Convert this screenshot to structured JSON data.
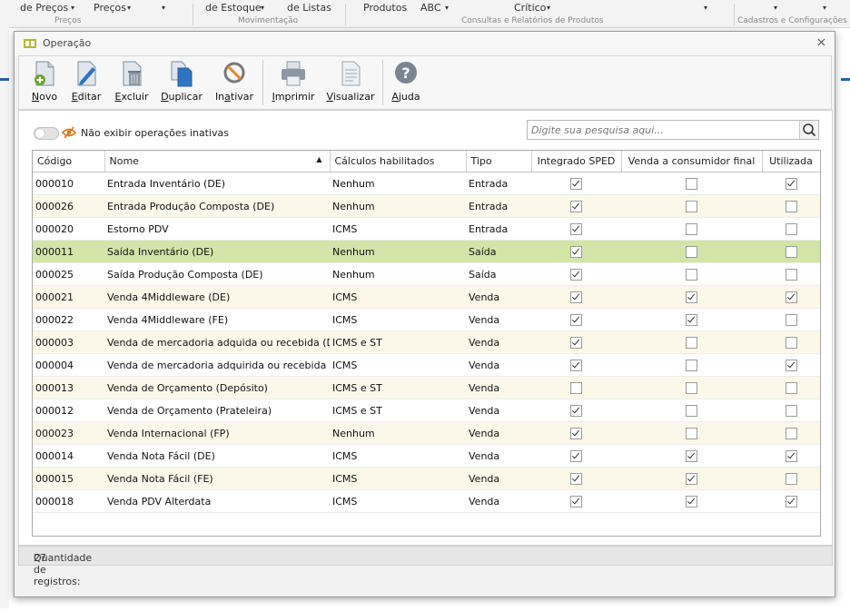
{
  "background_ribbon": {
    "items": [
      "de Preços",
      "Preços",
      "de Estoque",
      "de Listas",
      "Produtos",
      "ABC",
      "Crítico"
    ],
    "groups": [
      "Preços",
      "Movimentação",
      "Consultas e Relatórios de Produtos",
      "Cadastros e Configurações"
    ]
  },
  "dialog": {
    "title": "Operação",
    "close_label": "×"
  },
  "toolbar": {
    "buttons": [
      {
        "accel": "N",
        "rest": "ovo"
      },
      {
        "accel": "E",
        "rest": "ditar"
      },
      {
        "accel": "E",
        "rest": "xcluir",
        "pre": ""
      },
      {
        "accel": "D",
        "rest": "uplicar"
      },
      {
        "accel": "a",
        "pre": "In",
        "rest": "tivar"
      },
      {
        "accel": "I",
        "rest": "mprimir"
      },
      {
        "accel": "V",
        "rest": "isualizar"
      },
      {
        "accel": "A",
        "rest": "juda"
      }
    ]
  },
  "filter": {
    "toggle_on": false,
    "label": "Não exibir operações inativas"
  },
  "search": {
    "placeholder": "Digite sua pesquisa aqui..."
  },
  "grid": {
    "columns": [
      "Código",
      "Nome",
      "Cálculos habilitados",
      "Tipo",
      "Integrado SPED",
      "Venda a consumidor final",
      "Utilizada"
    ],
    "sorted_column": "Nome",
    "selected_row_color": "#d3e4a8",
    "alt_row_color": "#fbf8ea",
    "rows": [
      {
        "codigo": "000010",
        "nome": "Entrada Inventário (DE)",
        "calculos": "Nenhum",
        "tipo": "Entrada",
        "sped": true,
        "consumidor": false,
        "utilizada": true
      },
      {
        "codigo": "000026",
        "nome": "Entrada Produção Composta (DE)",
        "calculos": "Nenhum",
        "tipo": "Entrada",
        "sped": true,
        "consumidor": false,
        "utilizada": false
      },
      {
        "codigo": "000020",
        "nome": "Estorno PDV",
        "calculos": "ICMS",
        "tipo": "Entrada",
        "sped": true,
        "consumidor": false,
        "utilizada": false
      },
      {
        "codigo": "000011",
        "nome": "Saída Inventário (DE)",
        "calculos": "Nenhum",
        "tipo": "Saída",
        "sped": true,
        "consumidor": false,
        "utilizada": false,
        "selected": true
      },
      {
        "codigo": "000025",
        "nome": "Saída Produção Composta (DE)",
        "calculos": "Nenhum",
        "tipo": "Saída",
        "sped": true,
        "consumidor": false,
        "utilizada": false
      },
      {
        "codigo": "000021",
        "nome": "Venda 4Middleware (DE)",
        "calculos": "ICMS",
        "tipo": "Venda",
        "sped": true,
        "consumidor": true,
        "utilizada": true
      },
      {
        "codigo": "000022",
        "nome": "Venda 4Middleware (FE)",
        "calculos": "ICMS",
        "tipo": "Venda",
        "sped": true,
        "consumidor": true,
        "utilizada": false
      },
      {
        "codigo": "000003",
        "nome": "Venda de mercadoria adquida ou recebida (DE",
        "calculos": "ICMS e ST",
        "tipo": "Venda",
        "sped": true,
        "consumidor": false,
        "utilizada": false
      },
      {
        "codigo": "000004",
        "nome": "Venda de mercadoria adquirida ou recebida (FI",
        "calculos": "ICMS",
        "tipo": "Venda",
        "sped": true,
        "consumidor": false,
        "utilizada": true
      },
      {
        "codigo": "000013",
        "nome": "Venda de Orçamento (Depósito)",
        "calculos": "ICMS e ST",
        "tipo": "Venda",
        "sped": false,
        "consumidor": false,
        "utilizada": false
      },
      {
        "codigo": "000012",
        "nome": "Venda de Orçamento (Prateleira)",
        "calculos": "ICMS e ST",
        "tipo": "Venda",
        "sped": true,
        "consumidor": false,
        "utilizada": false
      },
      {
        "codigo": "000023",
        "nome": "Venda Internacional (FP)",
        "calculos": "Nenhum",
        "tipo": "Venda",
        "sped": true,
        "consumidor": false,
        "utilizada": false
      },
      {
        "codigo": "000014",
        "nome": "Venda Nota Fácil (DE)",
        "calculos": "ICMS",
        "tipo": "Venda",
        "sped": true,
        "consumidor": true,
        "utilizada": true
      },
      {
        "codigo": "000015",
        "nome": "Venda Nota Fácil (FE)",
        "calculos": "ICMS",
        "tipo": "Venda",
        "sped": true,
        "consumidor": true,
        "utilizada": false
      },
      {
        "codigo": "000018",
        "nome": "Venda PDV Alterdata",
        "calculos": "ICMS",
        "tipo": "Venda",
        "sped": true,
        "consumidor": true,
        "utilizada": true
      }
    ]
  },
  "status": {
    "label": "Quantidade de registros:",
    "count": "27"
  }
}
